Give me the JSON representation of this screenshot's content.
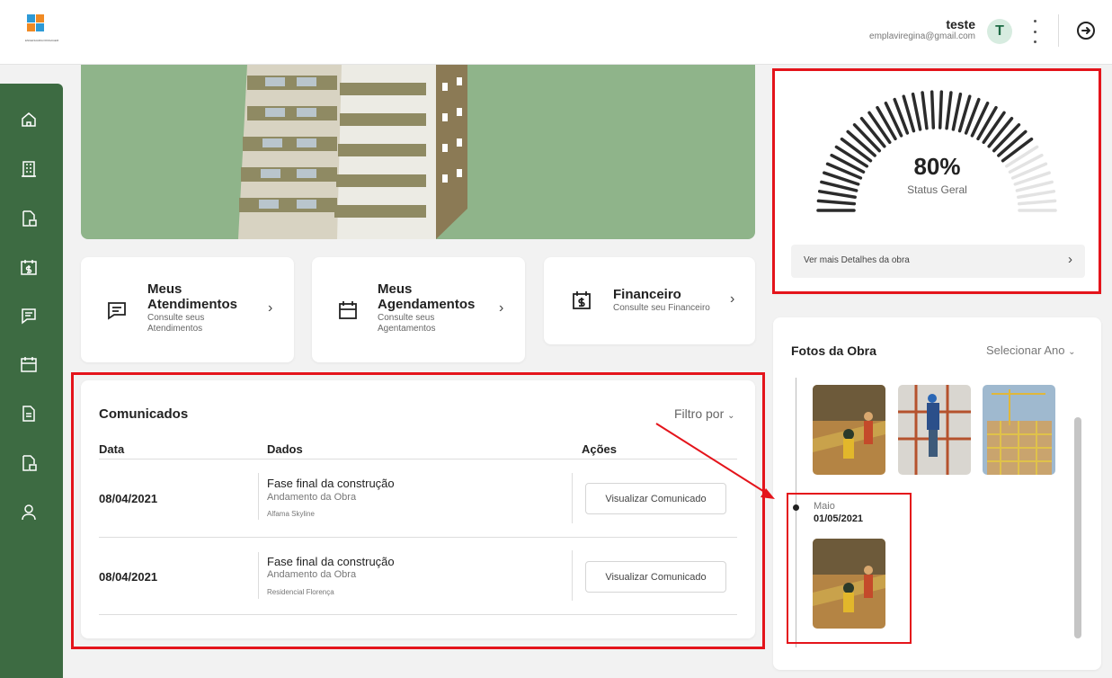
{
  "header": {
    "logo_caption": "ENGENHARIA PASSAGEM",
    "user_name": "teste",
    "user_email": "emplaviregina@gmail.com",
    "avatar_letter": "T"
  },
  "sidebar": {
    "items": [
      "home-icon",
      "building-icon",
      "document-building-icon",
      "money-calendar-icon",
      "chat-icon",
      "calendar-icon",
      "file-icon",
      "document-building-icon",
      "user-icon"
    ]
  },
  "shortcuts": {
    "atendimentos": {
      "title_1": "Meus",
      "title_2": "Atendimentos",
      "sub_1": "Consulte seus",
      "sub_2": "Atendimentos"
    },
    "agendamentos": {
      "title_1": "Meus",
      "title_2": "Agendamentos",
      "sub_1": "Consulte seus",
      "sub_2": "Agentamentos"
    },
    "financeiro": {
      "title": "Financeiro",
      "sub": "Consulte seu Financeiro"
    },
    "chevron": "›"
  },
  "comunicados": {
    "title": "Comunicados",
    "filter": "Filtro por",
    "columns": [
      "Data",
      "Dados",
      "Ações"
    ],
    "rows": [
      {
        "date": "08/04/2021",
        "title": "Fase final da construção",
        "subtitle": "Andamento da Obra",
        "project": "Alfama Skyline",
        "action": "Visualizar Comunicado"
      },
      {
        "date": "08/04/2021",
        "title": "Fase final da construção",
        "subtitle": "Andamento da Obra",
        "project": "Residencial Florença",
        "action": "Visualizar Comunicado"
      }
    ]
  },
  "status": {
    "percent": 80,
    "percent_label": "80%",
    "label": "Status Geral",
    "details_link": "Ver mais Detalhes da obra",
    "chevron": "›"
  },
  "fotos": {
    "title": "Fotos da Obra",
    "year_select": "Selecionar Ano",
    "entry_month": "Maio",
    "entry_date": "01/05/2021"
  },
  "colors": {
    "sidebar": "#3d6b42",
    "hero_bg": "#8fb48a",
    "annotation": "#e4141b"
  }
}
